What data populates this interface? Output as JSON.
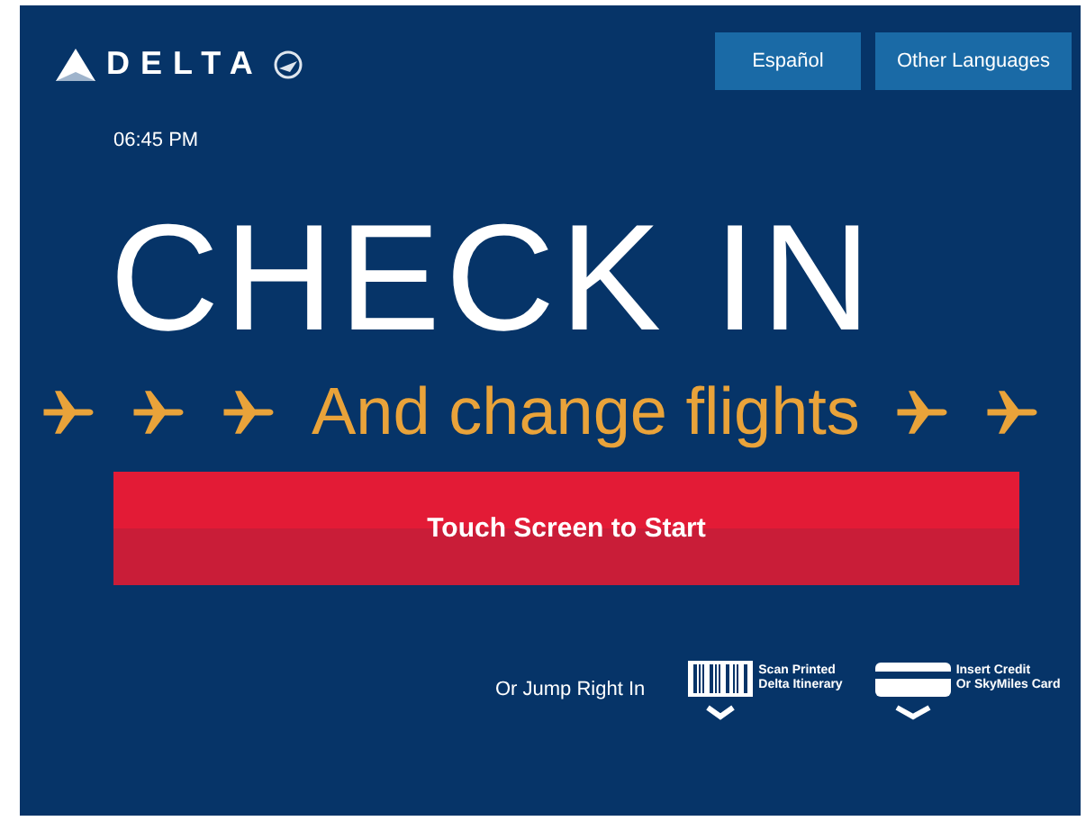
{
  "logo": {
    "wordmark": "DELTA"
  },
  "language_buttons": [
    "Español",
    "Other Languages"
  ],
  "time": "06:45 PM",
  "headline": "CHECK IN",
  "subheadline": {
    "text": "And change flights"
  },
  "start_button": "Touch Screen to Start",
  "jump_label": "Or Jump Right In",
  "options": [
    {
      "kind": "barcode",
      "lines": [
        "Scan Printed",
        "Delta Itinerary"
      ]
    },
    {
      "kind": "card",
      "lines": [
        "Insert Credit",
        "Or SkyMiles Card"
      ]
    }
  ]
}
